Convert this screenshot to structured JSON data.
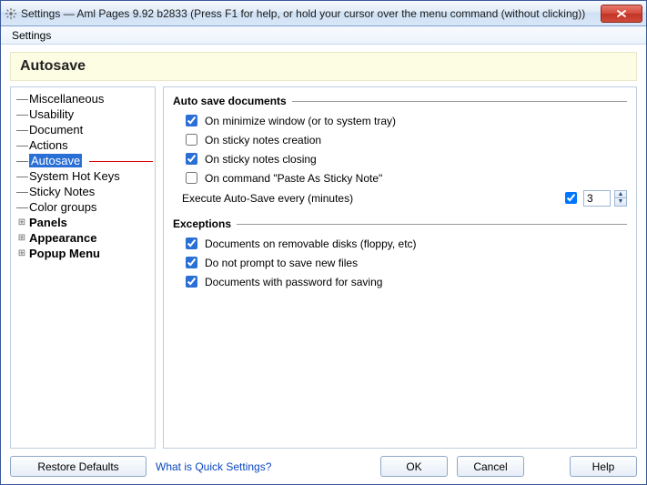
{
  "titlebar": {
    "text": "Settings  —  Aml Pages 9.92 b2833 (Press F1 for help, or hold your cursor over the menu command (without clicking))"
  },
  "menubar": {
    "settings": "Settings"
  },
  "page_header": "Autosave",
  "tree": [
    {
      "label": "Miscellaneous",
      "expandable": false
    },
    {
      "label": "Usability",
      "expandable": false
    },
    {
      "label": "Document",
      "expandable": false
    },
    {
      "label": "Actions",
      "expandable": false
    },
    {
      "label": "Autosave",
      "expandable": false,
      "selected": true
    },
    {
      "label": "System Hot Keys",
      "expandable": false
    },
    {
      "label": "Sticky Notes",
      "expandable": false
    },
    {
      "label": "Color groups",
      "expandable": false
    },
    {
      "label": "Panels",
      "expandable": true,
      "bold": true
    },
    {
      "label": "Appearance",
      "expandable": true,
      "bold": true
    },
    {
      "label": "Popup Menu",
      "expandable": true,
      "bold": true
    }
  ],
  "groups": {
    "autosave": {
      "title": "Auto save documents",
      "items": [
        {
          "label": "On minimize window (or to system tray)",
          "checked": true
        },
        {
          "label": "On sticky notes creation",
          "checked": false
        },
        {
          "label": "On sticky notes closing",
          "checked": true
        },
        {
          "label": "On command \"Paste As Sticky Note\"",
          "checked": false
        }
      ],
      "interval": {
        "label": "Execute Auto-Save every (minutes)",
        "enabled": true,
        "value": "3"
      }
    },
    "exceptions": {
      "title": "Exceptions",
      "items": [
        {
          "label": "Documents on removable disks (floppy, etc)",
          "checked": true
        },
        {
          "label": "Do not prompt to save new files",
          "checked": true
        },
        {
          "label": "Documents with password for saving",
          "checked": true
        }
      ]
    }
  },
  "footer": {
    "restore": "Restore Defaults",
    "quick_link": "What is Quick Settings?",
    "ok": "OK",
    "cancel": "Cancel",
    "help": "Help"
  }
}
